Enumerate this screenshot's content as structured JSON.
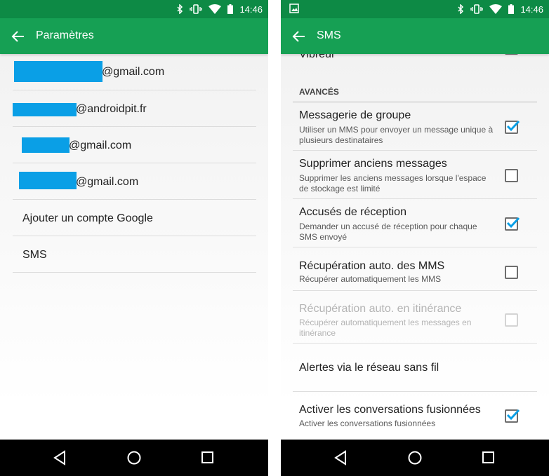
{
  "status": {
    "time": "14:46"
  },
  "left": {
    "title": "Paramètres",
    "accounts": [
      {
        "suffix": "@gmail.com"
      },
      {
        "suffix": "@androidpit.fr"
      },
      {
        "suffix": "@gmail.com"
      },
      {
        "suffix": "@gmail.com"
      }
    ],
    "add_account": "Ajouter un compte Google",
    "sms": "SMS"
  },
  "right": {
    "title": "SMS",
    "partial_item": "Vibreur",
    "section_header": "AVANCÉS",
    "items": [
      {
        "title": "Messagerie de groupe",
        "summary": "Utiliser un MMS pour envoyer un message unique à plusieurs destinataires",
        "checked": true,
        "enabled": true
      },
      {
        "title": "Supprimer anciens messages",
        "summary": "Supprimer les anciens messages lorsque l'espace de stockage est limité",
        "checked": false,
        "enabled": true
      },
      {
        "title": "Accusés de réception",
        "summary": "Demander un accusé de réception pour chaque SMS envoyé",
        "checked": true,
        "enabled": true
      },
      {
        "title": "Récupération auto. des MMS",
        "summary": "Récupérer automatiquement les MMS",
        "checked": false,
        "enabled": true
      },
      {
        "title": "Récupération auto. en itinérance",
        "summary": "Récupérer automatiquement les messages en itinérance",
        "checked": false,
        "enabled": false
      },
      {
        "title": "Alertes via le réseau sans fil",
        "summary": "",
        "checked": null,
        "enabled": true
      },
      {
        "title": "Activer les conversations fusionnées",
        "summary": "Activer les conversations fusionnées",
        "checked": true,
        "enabled": true
      }
    ]
  },
  "colors": {
    "status_bar": "#0d8a45",
    "app_bar": "#16a054",
    "check_accent": "#0a9fe6",
    "redaction": "#0a9fe6"
  }
}
